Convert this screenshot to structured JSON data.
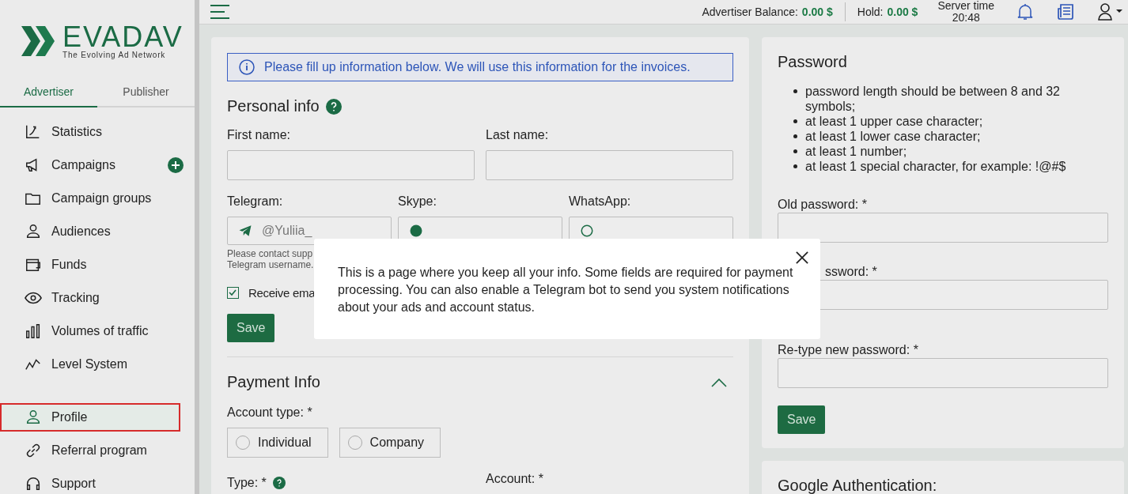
{
  "logo": {
    "name": "EVADAV",
    "tagline": "The Evolving Ad Network"
  },
  "sidebar": {
    "tabs": [
      {
        "label": "Advertiser",
        "selected": true
      },
      {
        "label": "Publisher",
        "selected": false
      }
    ],
    "items": [
      {
        "label": "Statistics",
        "selected": false,
        "has_add": false
      },
      {
        "label": "Campaigns",
        "selected": false,
        "has_add": true
      },
      {
        "label": "Campaign groups",
        "selected": false,
        "has_add": false
      },
      {
        "label": "Audiences",
        "selected": false,
        "has_add": false
      },
      {
        "label": "Funds",
        "selected": false,
        "has_add": false
      },
      {
        "label": "Tracking",
        "selected": false,
        "has_add": false
      },
      {
        "label": "Volumes of traffic",
        "selected": false,
        "has_add": false
      },
      {
        "label": "Level System",
        "selected": false,
        "has_add": false
      }
    ],
    "bottom_items": [
      {
        "label": "Profile",
        "selected": true,
        "has_add": false
      },
      {
        "label": "Referral program",
        "selected": false,
        "has_add": false
      },
      {
        "label": "Support",
        "selected": false,
        "has_add": false
      }
    ]
  },
  "topbar": {
    "balance_label": "Advertiser Balance:",
    "balance_value": "0.00 $",
    "hold_label": "Hold:",
    "hold_value": "0.00 $",
    "server_time_label": "Server time",
    "server_time": "20:48"
  },
  "personal": {
    "notice": "Please fill up information below. We will use this information for the invoices.",
    "title": "Personal info",
    "first_name_label": "First name:",
    "last_name_label": "Last name:",
    "telegram_label": "Telegram:",
    "skype_label": "Skype:",
    "whatsapp_label": "WhatsApp:",
    "telegram_value": "@Yuliia_",
    "help_lines": [
      "Please contact supp",
      "Telegram username."
    ],
    "receive_label": "Receive ema",
    "receive_checked": true,
    "save": "Save"
  },
  "payment": {
    "title": "Payment Info",
    "expanded": true,
    "account_type_label": "Account type: *",
    "options": [
      {
        "label": "Individual",
        "selected": false
      },
      {
        "label": "Company",
        "selected": false
      }
    ],
    "type_label": "Type: *",
    "account_label": "Account: *"
  },
  "password": {
    "title": "Password",
    "rules": [
      "password length should be between 8 and 32 symbols;",
      "at least 1 upper case character;",
      "at least 1 lower case character;",
      "at least 1 number;",
      "at least 1 special character, for example: !@#$"
    ],
    "old_label": "Old password: *",
    "new_label": "ssword: *",
    "retype_label": "Re-type new password: *",
    "save": "Save"
  },
  "google": {
    "title": "Google Authentication:"
  },
  "modal": {
    "text": "This is a page where you keep all your info. Some fields are required for payment processing. You can also enable a Telegram bot to send you system notifications about your ads and account status."
  }
}
